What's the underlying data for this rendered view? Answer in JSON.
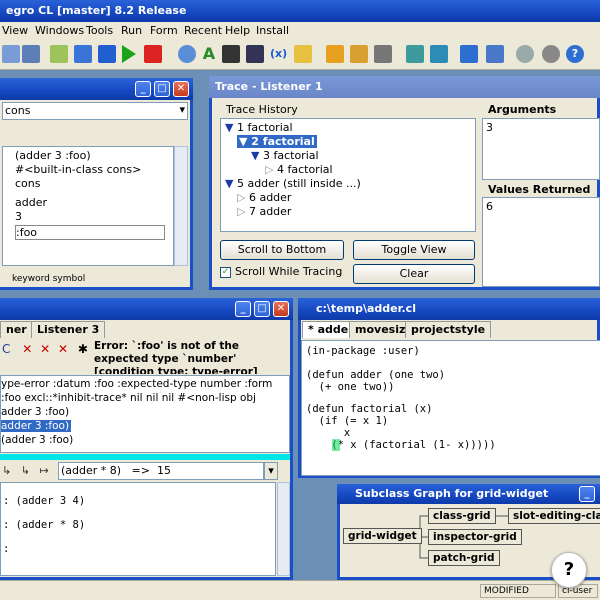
{
  "app": {
    "title": "egro CL [master] 8.2 Release"
  },
  "menu": [
    "View",
    "Windows",
    "Tools",
    "Run",
    "Form",
    "Recent",
    "Help",
    "Install"
  ],
  "inspector": {
    "field_value": "cons",
    "lines": [
      "(adder 3 :foo)",
      "#<built-in-class cons>",
      "cons",
      "adder",
      "3",
      ":foo"
    ],
    "status": "keyword symbol"
  },
  "trace": {
    "title": "Trace - Listener 1",
    "history_label": "Trace History",
    "arguments_label": "Arguments",
    "arguments_value": "3",
    "values_label": "Values Returned",
    "values_value": "6",
    "nodes": [
      "1 factorial",
      "2 factorial",
      "3 factorial",
      "4 factorial",
      "5 adder  (still inside ...)",
      "6 adder",
      "7 adder"
    ],
    "scroll_button": "Scroll to Bottom",
    "toggle_button": "Toggle View",
    "scroll_while_tracing": "Scroll While Tracing",
    "clear_button": "Clear"
  },
  "listener": {
    "tabs": [
      "ner 2",
      "Listener 3"
    ],
    "error_text": "Error: `:foo' is not of the expected type `number'",
    "error_text2": "[condition type: type-error]",
    "backtrace": [
      "ype-error  :datum  :foo  :expected-type  number  :form",
      "  :foo  excl::*inhibit-trace*  nil  nil  nil  #<non-lisp obj",
      " adder 3 :foo)",
      " adder 3 :foo)",
      "          (adder 3 :foo)"
    ],
    "combo_value": "(adder * 8)   =>  15",
    "repl": [
      ": (adder 3 4)",
      ": (adder * 8)",
      ":"
    ]
  },
  "editor": {
    "title": "c:\\temp\\adder.cl",
    "tabs": [
      "* adder",
      "movesize",
      "projectstyle"
    ],
    "code": [
      "(in-package :user)",
      "",
      "(defun adder (one two)",
      "  (+ one two))",
      "",
      "(defun factorial (x)",
      "  (if (= x 1)",
      "      x",
      "    (* x (factorial (1- x)))))"
    ]
  },
  "subclass_graph": {
    "title": "Subclass Graph for grid-widget",
    "root": "grid-widget",
    "children": [
      "class-grid",
      "inspector-grid",
      "patch-grid"
    ],
    "grandchild": "slot-editing-class-"
  },
  "statusbar": {
    "modified": "MODIFIED",
    "pkg": "cl-user"
  },
  "help_badge": "?",
  "colors": {
    "titlebar": "#1547c0",
    "selection": "#316ac5",
    "cyan_strip": "#00e5e5"
  }
}
